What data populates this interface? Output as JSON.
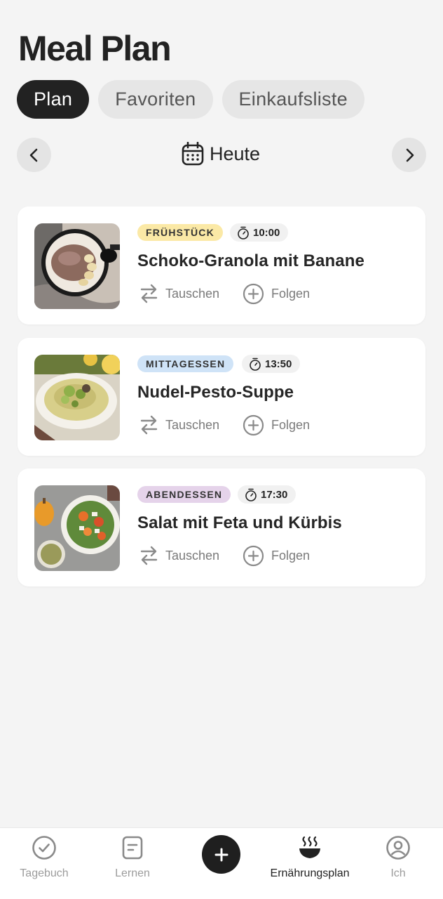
{
  "header": {
    "title": "Meal Plan"
  },
  "tabs": [
    {
      "label": "Plan",
      "active": true
    },
    {
      "label": "Favoriten",
      "active": false
    },
    {
      "label": "Einkaufsliste",
      "active": false
    }
  ],
  "date_nav": {
    "label": "Heute",
    "prev_icon": "chevron-left-icon",
    "next_icon": "chevron-right-icon",
    "calendar_icon": "calendar-icon"
  },
  "meals": [
    {
      "category": "FRÜHSTÜCK",
      "category_color": "#fbe9a6",
      "time": "10:00",
      "title": "Schoko-Granola mit Banane",
      "swap_label": "Tauschen",
      "follow_label": "Folgen"
    },
    {
      "category": "MITTAGESSEN",
      "category_color": "#cfe3f7",
      "time": "13:50",
      "title": "Nudel-Pesto-Suppe",
      "swap_label": "Tauschen",
      "follow_label": "Folgen"
    },
    {
      "category": "ABENDESSEN",
      "category_color": "#e5d3ea",
      "time": "17:30",
      "title": "Salat mit Feta und Kürbis",
      "swap_label": "Tauschen",
      "follow_label": "Folgen"
    }
  ],
  "bottom_nav": {
    "items": [
      {
        "label": "Tagebuch",
        "icon": "check-circle-icon"
      },
      {
        "label": "Lernen",
        "icon": "document-icon"
      },
      {
        "label": "Ernährungsplan",
        "icon": "bowl-icon",
        "active": true
      },
      {
        "label": "Ich",
        "icon": "user-circle-icon"
      }
    ],
    "add_icon": "plus-icon"
  }
}
